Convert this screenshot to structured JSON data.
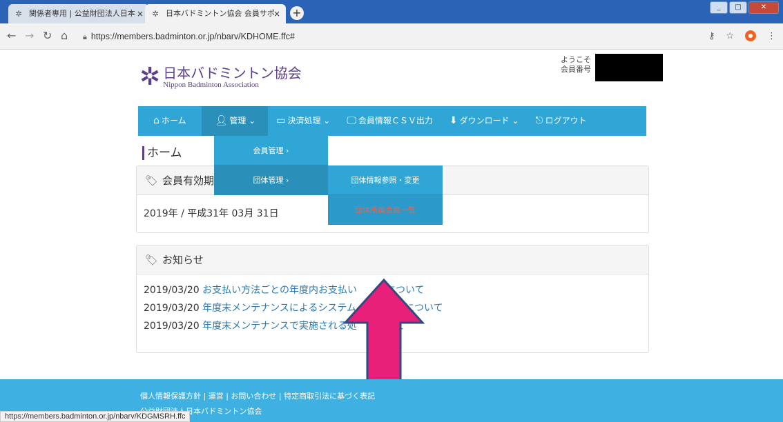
{
  "browser": {
    "tabs": [
      {
        "icon": "badminton-logo-icon",
        "title": "関係者専用 | 公益財団法人日本",
        "close": "×"
      },
      {
        "icon": "badminton-logo-icon",
        "title": "日本バドミントン協会 会員サポ",
        "close": "×"
      }
    ],
    "new_tab": "+",
    "url": "https://members.badminton.or.jp/nbarv/KDHOME.ffc#",
    "status_url": "https://members.badminton.or.jp/nbarv/KDGMSRH.ffc"
  },
  "header": {
    "logo_jp": "日本バドミントン協会",
    "logo_en": "Nippon Badminton Association",
    "welcome": "ようこそ",
    "member_no": "会員番号"
  },
  "nav": {
    "home": "ホーム",
    "manage": "管理",
    "payment": "決済処理",
    "csv": "会員情報ＣＳＶ出力",
    "download": "ダウンロード",
    "logout": "ログアウト"
  },
  "dropdown": {
    "member_manage": "会員管理 ›",
    "group_manage": "団体管理 ›",
    "group_info": "団体情報参照・変更",
    "group_members": "団体所属会員一覧"
  },
  "page": {
    "title": "ホーム",
    "validity_header": "会員有効期",
    "validity_value": "2019年 / 平成31年 03月 31日",
    "news_header": "お知らせ",
    "news": [
      {
        "date": "2019/03/20",
        "text": "お支払い方法ごとの年度内お支払い　　　について"
      },
      {
        "date": "2019/03/20",
        "text": "年度末メンテナンスによるシステム　　　期限について"
      },
      {
        "date": "2019/03/20",
        "text": "年度末メンテナンスで実施される処　　　いて"
      }
    ]
  },
  "footer": {
    "links": "個人情報保護方針 | 運営 | お問い合わせ | 特定商取引法に基づく表記",
    "org": "公益財団法人日本バドミントン協会"
  },
  "colors": {
    "nav": "#2fa6d5",
    "arrow": "#e8207a",
    "arrow_border": "#2e4a80",
    "footer": "#3eb0e1"
  }
}
